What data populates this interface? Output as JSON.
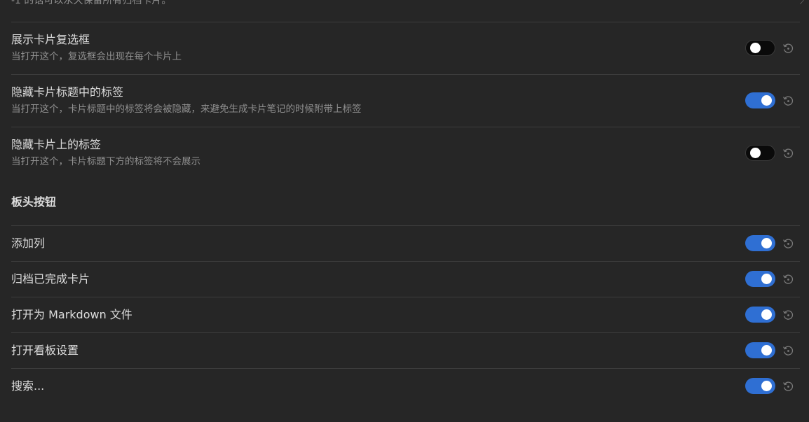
{
  "top_truncated_description": "-1 的话可以永久保留所有归档卡片。",
  "colors": {
    "background": "#262626",
    "divider": "#3d3d3d",
    "toggle_on": "#2f6fd3",
    "toggle_off": "#0a0a0a",
    "text_primary": "#dcdcdc",
    "text_muted": "#8f8f8f"
  },
  "card_settings": [
    {
      "title": "展示卡片复选框",
      "description": "当打开这个，复选框会出现在每个卡片上",
      "enabled": false,
      "reset_icon": "reset-icon"
    },
    {
      "title": "隐藏卡片标题中的标签",
      "description": "当打开这个，卡片标题中的标签将会被隐藏，来避免生成卡片笔记的时候附带上标签",
      "enabled": true,
      "reset_icon": "reset-icon"
    },
    {
      "title": "隐藏卡片上的标签",
      "description": "当打开这个，卡片标题下方的标签将不会展示",
      "enabled": false,
      "reset_icon": "reset-icon"
    }
  ],
  "board_header": {
    "heading": "板头按钮",
    "buttons": [
      {
        "title": "添加列",
        "enabled": true
      },
      {
        "title": "归档已完成卡片",
        "enabled": true
      },
      {
        "title": "打开为 Markdown 文件",
        "enabled": true
      },
      {
        "title": "打开看板设置",
        "enabled": true
      },
      {
        "title": "搜索...",
        "enabled": true
      }
    ]
  }
}
